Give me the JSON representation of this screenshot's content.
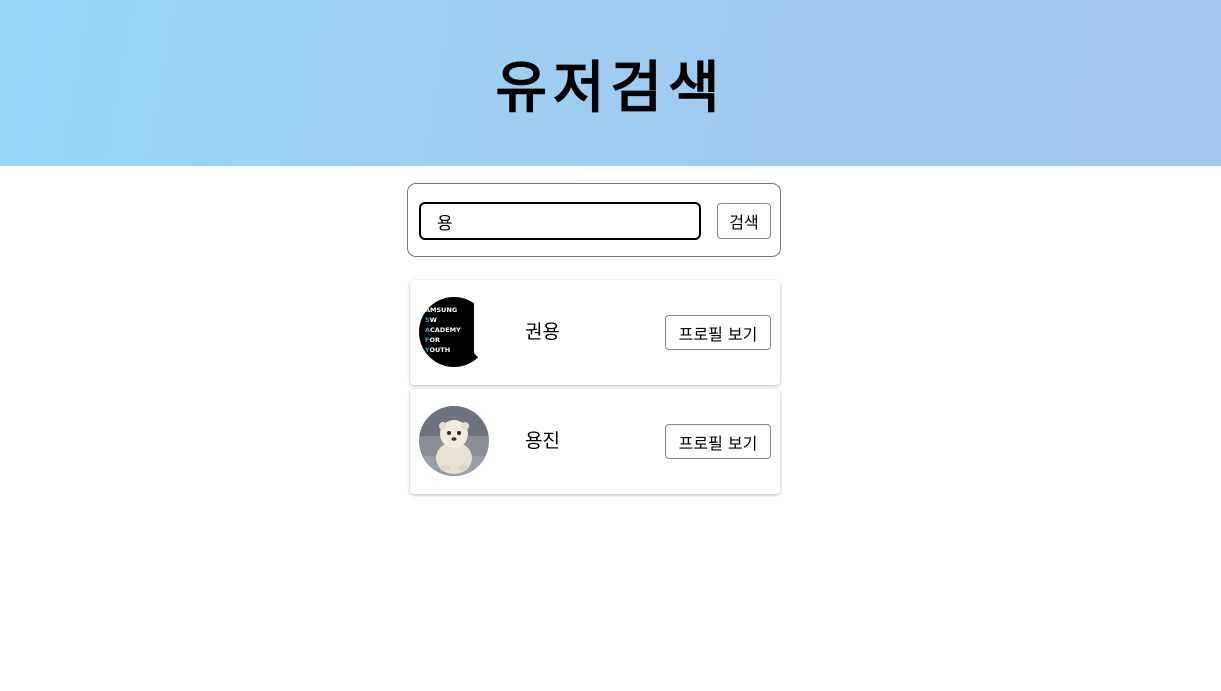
{
  "header": {
    "title": "유저검색"
  },
  "search": {
    "value": "용",
    "button_label": "검색"
  },
  "results": [
    {
      "name": "권용",
      "avatar": "samsung-sw-academy-logo",
      "avatar_text": "SAMSUNG SW ACADEMY FOR YOUTH",
      "button_label": "프로필 보기"
    },
    {
      "name": "용진",
      "avatar": "seal-pup-photo",
      "button_label": "프로필 보기"
    }
  ],
  "colors": {
    "header_gradient_start": "#98d6f8",
    "header_gradient_end": "#a2c6ec",
    "accent_blue": "#3aa0d8"
  }
}
